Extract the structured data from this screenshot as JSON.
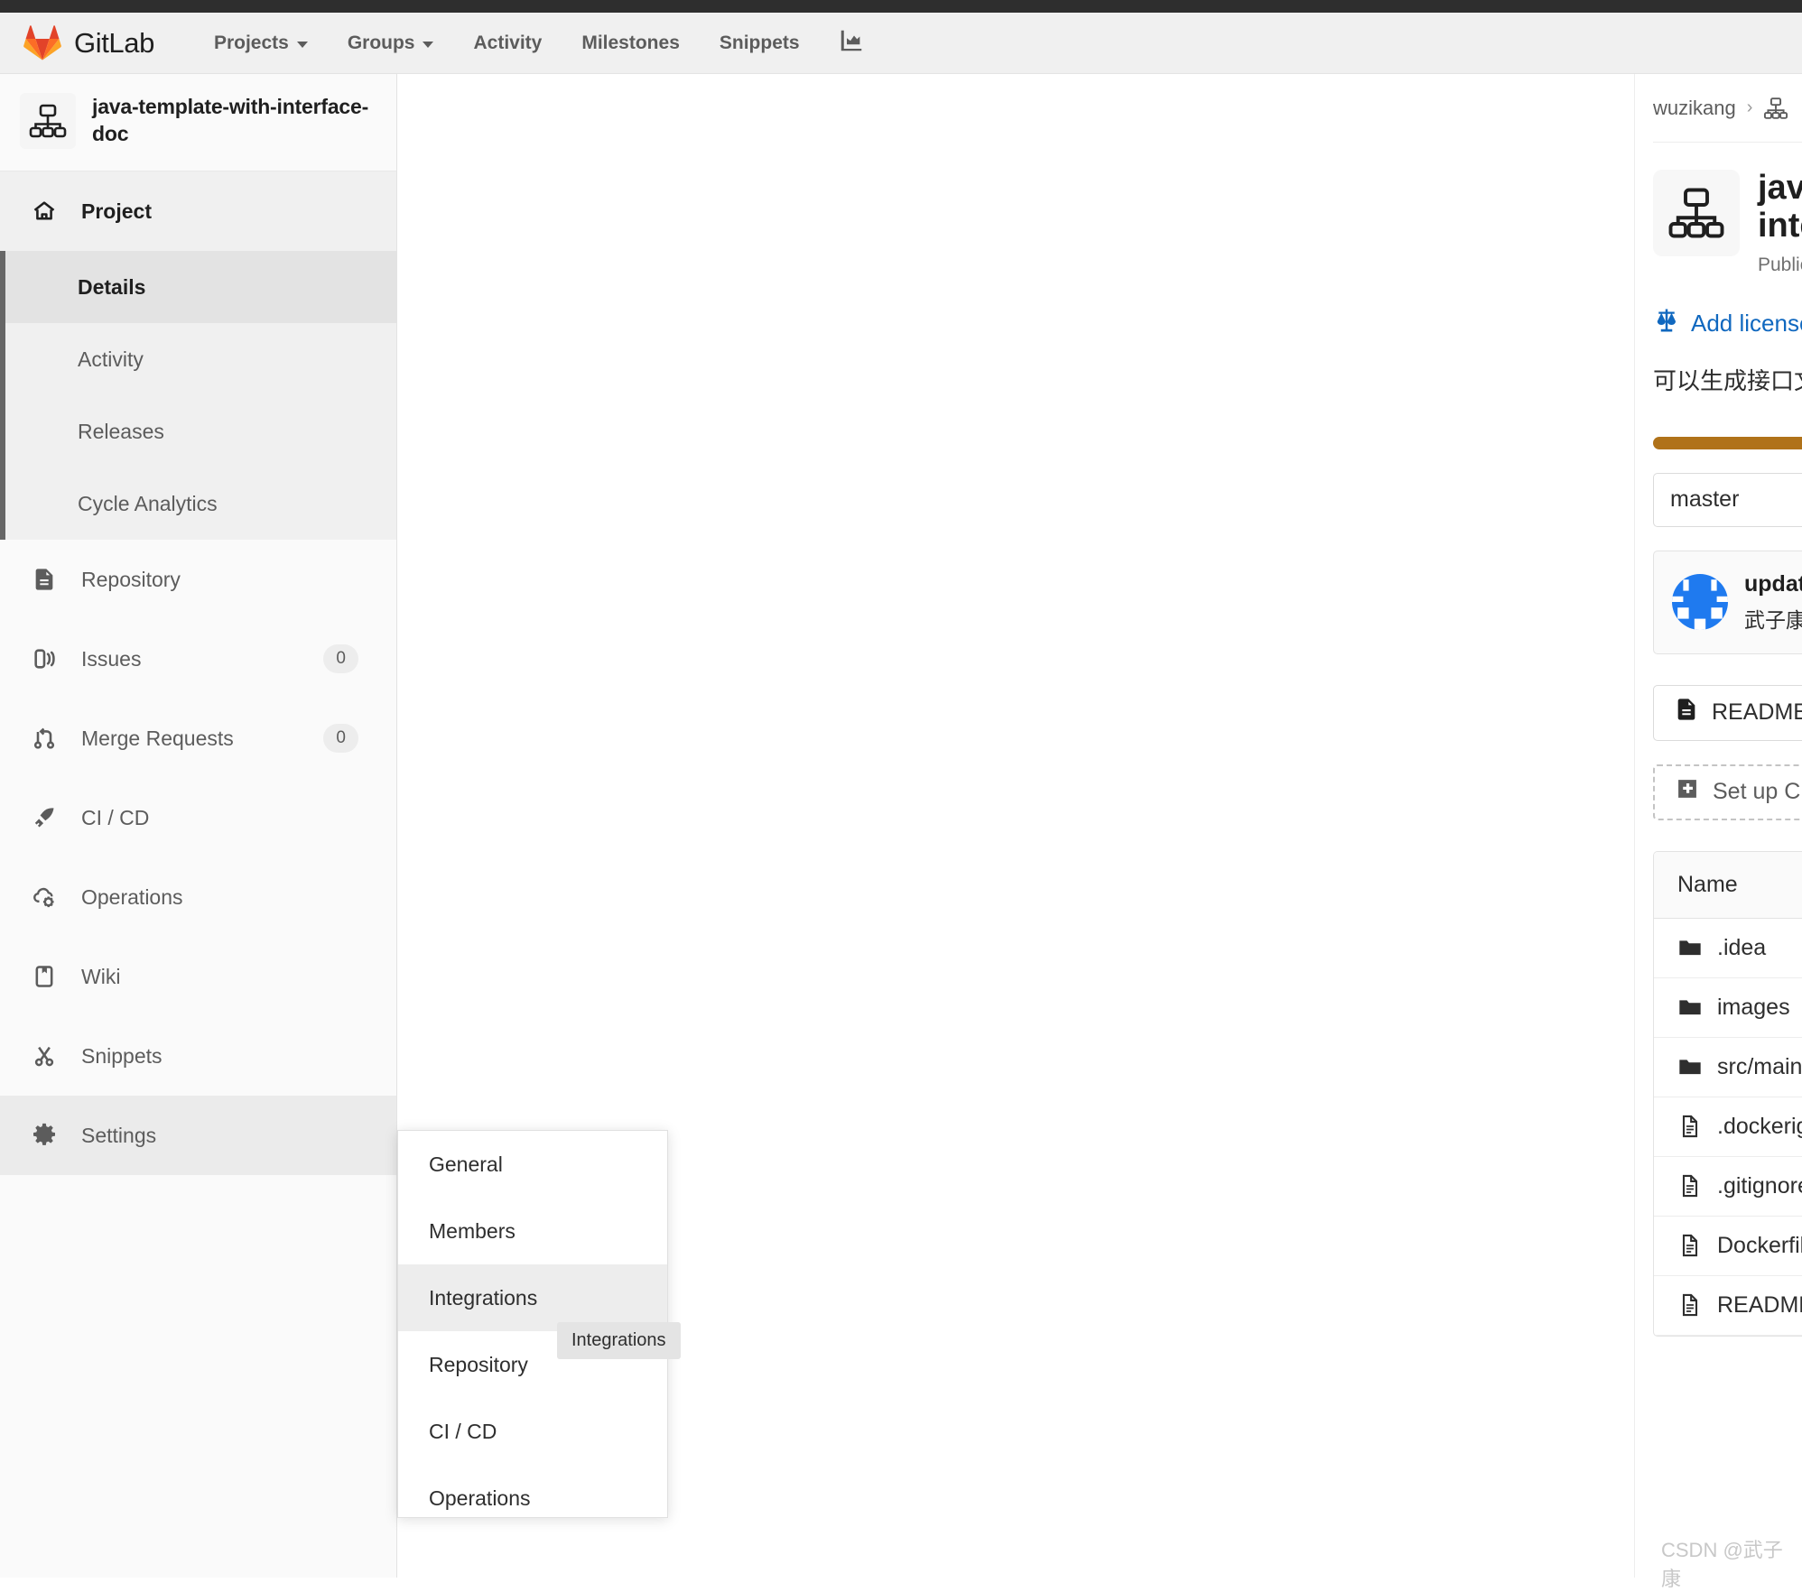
{
  "header": {
    "brand": "GitLab",
    "nav": [
      {
        "label": "Projects",
        "has_caret": true
      },
      {
        "label": "Groups",
        "has_caret": true
      },
      {
        "label": "Activity",
        "has_caret": false
      },
      {
        "label": "Milestones",
        "has_caret": false
      },
      {
        "label": "Snippets",
        "has_caret": false
      }
    ],
    "analytics_icon": "chart-icon"
  },
  "sidebar": {
    "project_name": "java-template-with-interface-doc",
    "project_avatar_icon": "hierarchy-icon",
    "project_section": {
      "label": "Project",
      "icon": "home-icon",
      "sub_items": [
        {
          "label": "Details",
          "current": true
        },
        {
          "label": "Activity",
          "current": false
        },
        {
          "label": "Releases",
          "current": false
        },
        {
          "label": "Cycle Analytics",
          "current": false
        }
      ]
    },
    "items": [
      {
        "label": "Repository",
        "icon": "document-icon",
        "badge": ""
      },
      {
        "label": "Issues",
        "icon": "issue-icon",
        "badge": "0"
      },
      {
        "label": "Merge Requests",
        "icon": "merge-request-icon",
        "badge": "0"
      },
      {
        "label": "CI / CD",
        "icon": "rocket-icon",
        "badge": ""
      },
      {
        "label": "Operations",
        "icon": "cloud-gear-icon",
        "badge": ""
      },
      {
        "label": "Wiki",
        "icon": "book-icon",
        "badge": ""
      },
      {
        "label": "Snippets",
        "icon": "scissors-icon",
        "badge": ""
      },
      {
        "label": "Settings",
        "icon": "gear-icon",
        "badge": "",
        "active": true
      }
    ]
  },
  "flyout": {
    "items": [
      {
        "label": "General",
        "hover": false
      },
      {
        "label": "Members",
        "hover": false
      },
      {
        "label": "Integrations",
        "hover": true
      },
      {
        "label": "Repository",
        "hover": false
      },
      {
        "label": "CI / CD",
        "hover": false
      },
      {
        "label": "Operations",
        "hover": false
      }
    ]
  },
  "tooltip": {
    "text": "Integrations"
  },
  "right_panel": {
    "breadcrumb": {
      "group": "wuzikang",
      "separator": "›",
      "project_icon": "hierarchy-icon"
    },
    "project_title": "java-template-with-interface-doc",
    "visibility": "Public",
    "add_license_label": "Add license",
    "license_icon": "scales-icon",
    "description": "可以生成接口文档",
    "language_bar_color": "#b07219",
    "branch": "master",
    "commit": {
      "message": "update",
      "author": "武子康"
    },
    "buttons": [
      {
        "label": "README",
        "icon": "document-icon",
        "style": "solid"
      },
      {
        "label": "Set up CI/CD",
        "icon": "plus-box-icon",
        "style": "dashed"
      }
    ],
    "file_table": {
      "column": "Name",
      "rows": [
        {
          "name": ".idea",
          "type": "folder"
        },
        {
          "name": "images",
          "type": "folder"
        },
        {
          "name": "src/main",
          "type": "folder"
        },
        {
          "name": ".dockerignore",
          "type": "file"
        },
        {
          "name": ".gitignore",
          "type": "file"
        },
        {
          "name": "Dockerfile",
          "type": "file"
        },
        {
          "name": "README.md",
          "type": "file"
        }
      ]
    }
  },
  "watermark": {
    "text": "CSDN @武子康"
  }
}
